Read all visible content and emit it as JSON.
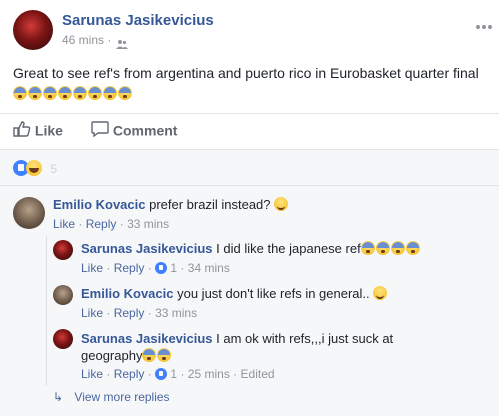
{
  "post": {
    "author": "Sarunas Jasikevicius",
    "time": "46 mins",
    "separator": "·",
    "text": "Great to see ref's from argentina and puerto rico in Eurobasket quarter final",
    "emoji_count": 8
  },
  "actions": {
    "like_label": "Like",
    "comment_label": "Comment"
  },
  "reactions": {
    "count": "5"
  },
  "comments": [
    {
      "author": "Emilio Kovacic",
      "text": "prefer brazil instead?",
      "like": "Like",
      "reply": "Reply",
      "time": "33 mins"
    }
  ],
  "replies": [
    {
      "author": "Sarunas Jasikevicius",
      "text": "I did like the japanese ref",
      "like": "Like",
      "reply": "Reply",
      "likes": "1",
      "time": "34 mins"
    },
    {
      "author": "Emilio Kovacic",
      "text": "you just don't like refs in general..",
      "like": "Like",
      "reply": "Reply",
      "time": "33 mins"
    },
    {
      "author": "Sarunas Jasikevicius",
      "text_line1": "I am ok with refs,,,i just suck at",
      "text_line2": "geography",
      "like": "Like",
      "reply": "Reply",
      "likes": "1",
      "time": "25 mins",
      "edited": "Edited"
    }
  ],
  "more_replies": {
    "arrow": "↳",
    "label": "View more replies"
  },
  "colors": {
    "link": "#365899",
    "muted": "#90949c",
    "accent_like": "#4080ff"
  }
}
